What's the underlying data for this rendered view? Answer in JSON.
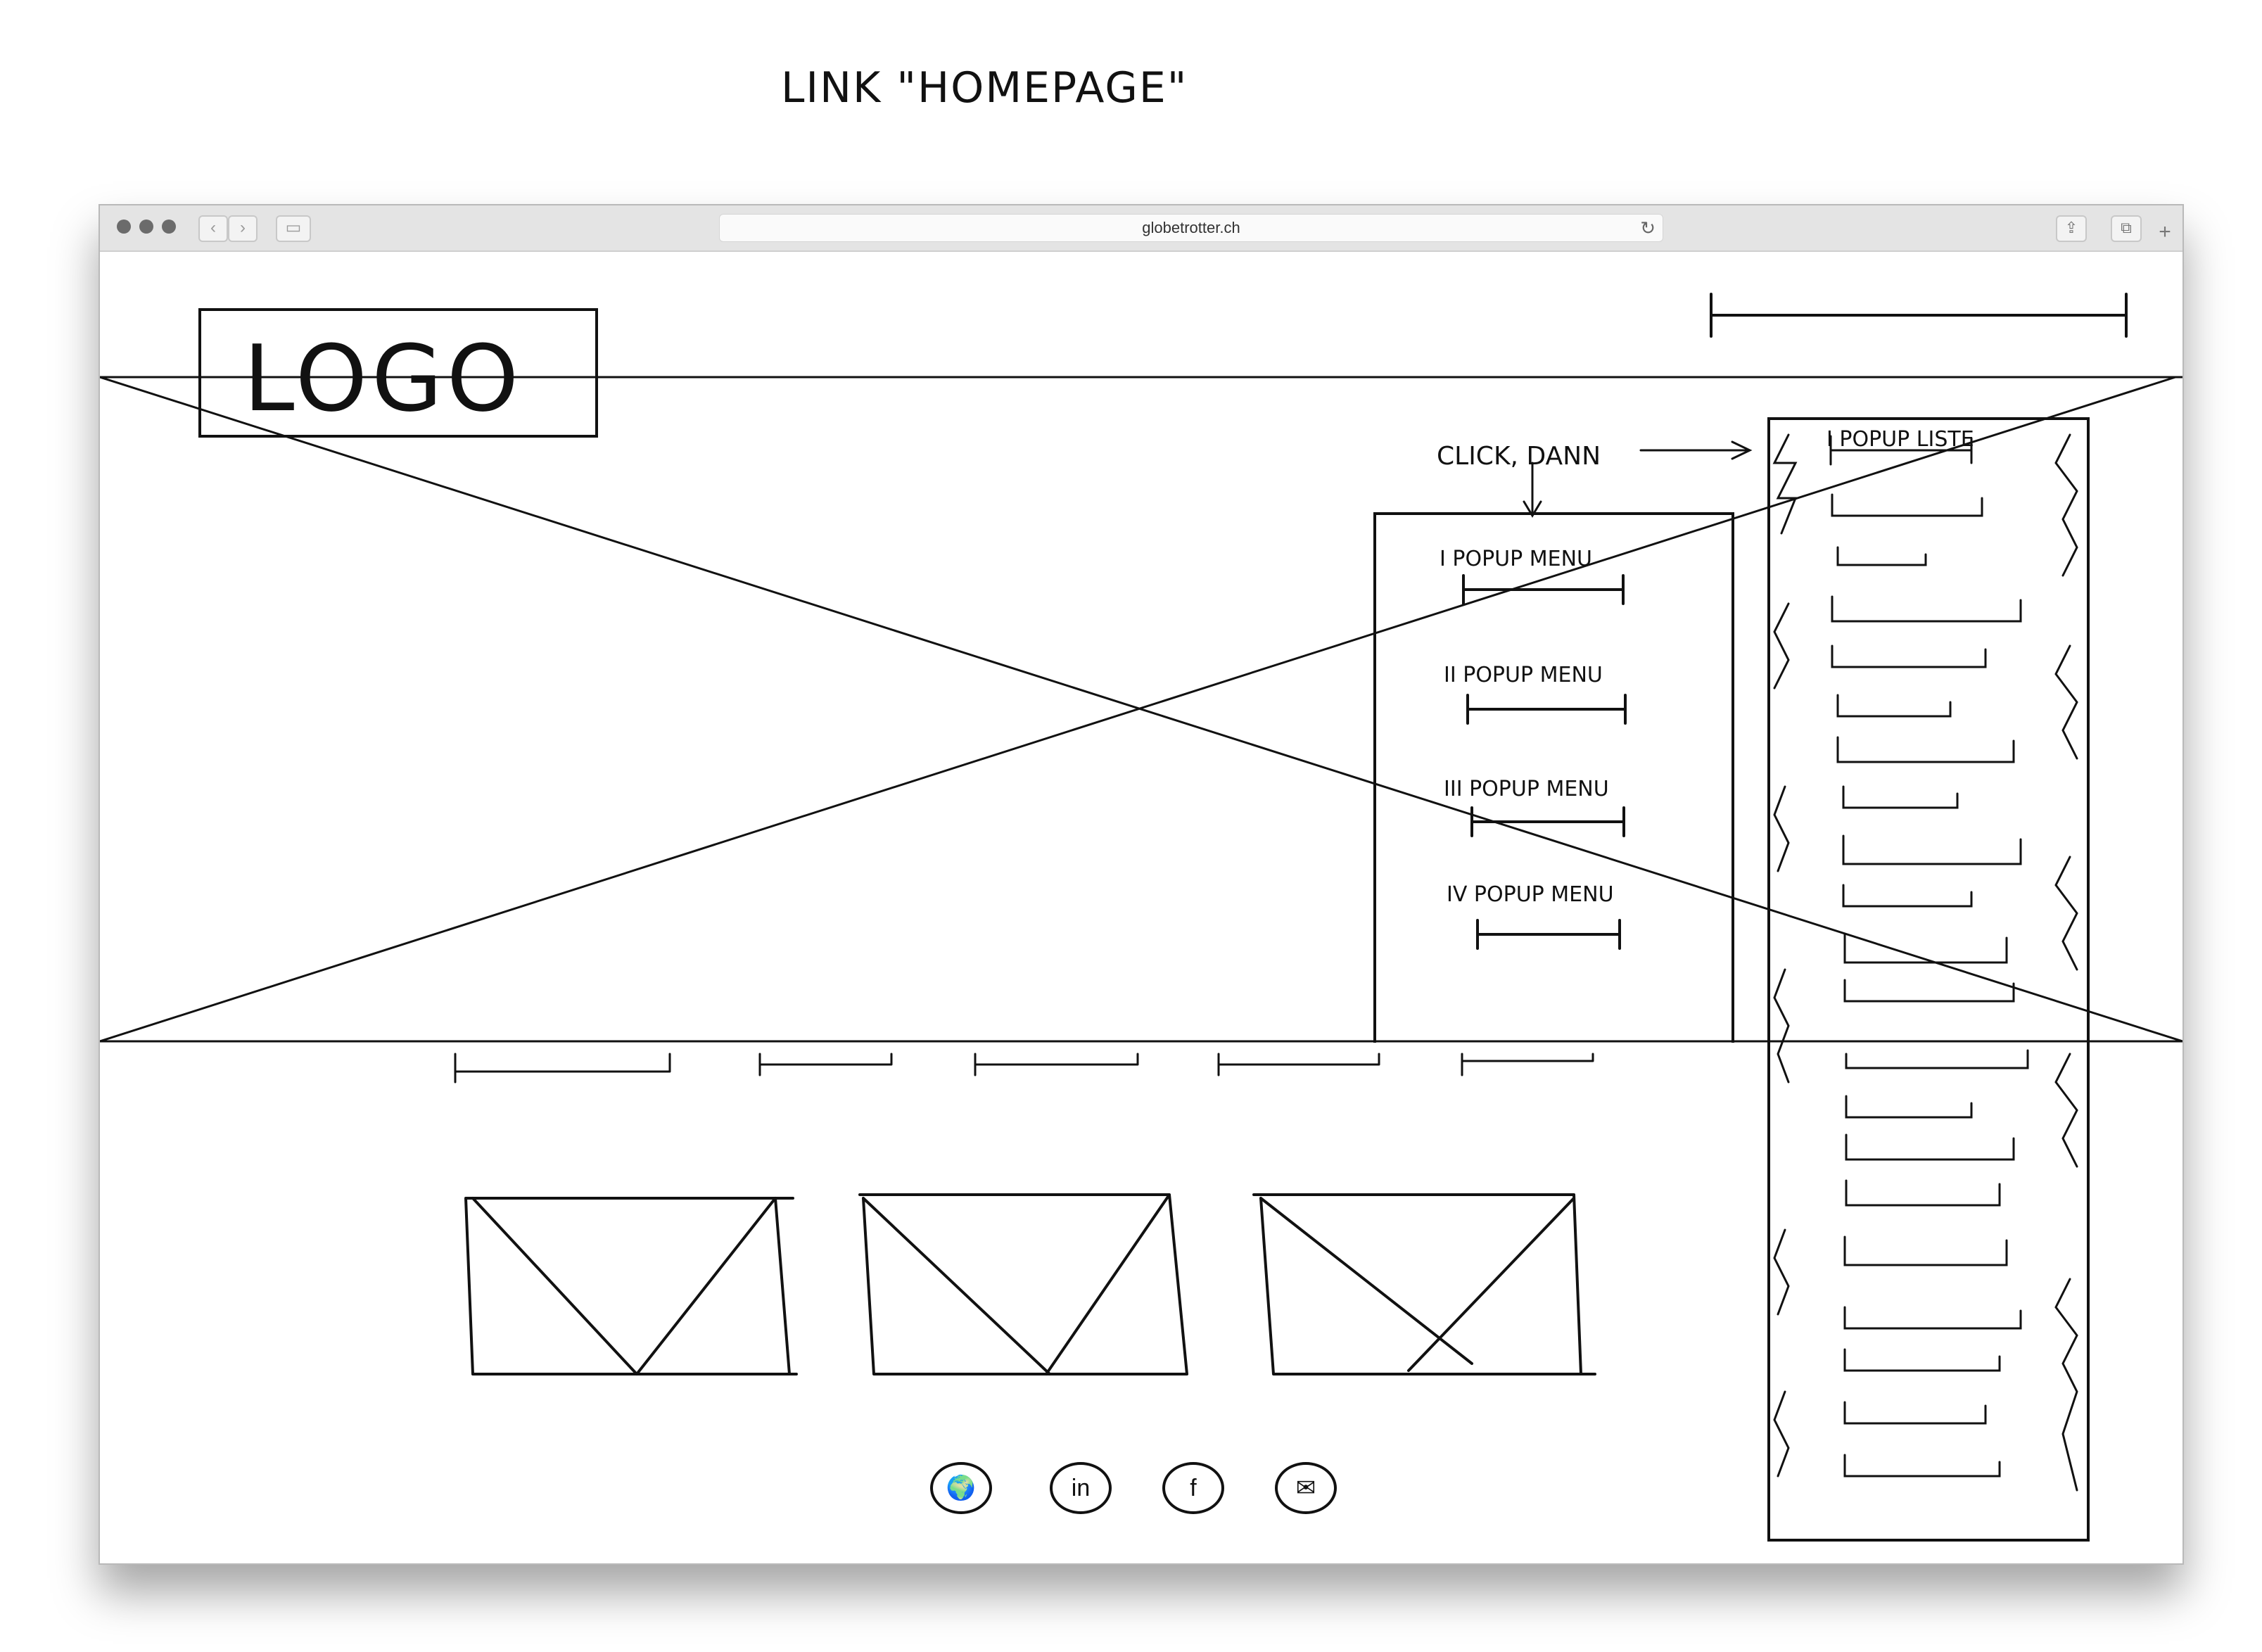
{
  "page_title": "LINK \"HOMEPAGE\"",
  "browser": {
    "url": "globetrotter.ch",
    "back_label": "‹",
    "forward_label": "›",
    "sidebar_icon": "▭",
    "reload_icon": "↻",
    "share_icon": "⇪",
    "tabs_icon": "⧉",
    "new_tab_label": "+"
  },
  "header": {
    "logo_text": "LOGO"
  },
  "annotation": {
    "click_note": "CLICK, DANN"
  },
  "popup_menu": {
    "items": [
      {
        "label": "I POPUP MENU"
      },
      {
        "label": "II POPUP MENU"
      },
      {
        "label": "III POPUP MENU"
      },
      {
        "label": "IV POPUP MENU"
      }
    ]
  },
  "popup_list": {
    "title": "I POPUP LISTE"
  },
  "social": {
    "icons": [
      "globe-icon",
      "linkedin-icon",
      "facebook-icon",
      "mail-icon"
    ],
    "labels": [
      "🌍",
      "in",
      "f",
      "✉"
    ]
  }
}
